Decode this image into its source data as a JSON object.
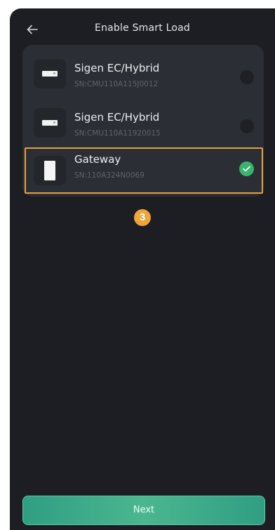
{
  "header": {
    "title": "Enable Smart Load",
    "back_icon": "arrow-left-icon"
  },
  "devices": [
    {
      "name": "Sigen EC/Hybrid",
      "sn": "SN:CMU110A115J0012",
      "selected": false,
      "icon": "inverter-device-icon"
    },
    {
      "name": "Sigen EC/Hybrid",
      "sn": "SN:CMU110A11920015",
      "selected": false,
      "icon": "inverter-device-icon"
    },
    {
      "name": "Gateway",
      "sn": "SN:110A324N0069",
      "selected": true,
      "icon": "gateway-device-icon"
    }
  ],
  "annotation": {
    "step_number": "3",
    "highlight_color": "#e9a03a"
  },
  "footer": {
    "next_label": "Next"
  },
  "colors": {
    "background": "#1c1e23",
    "card": "#2b2e34",
    "accent": "#39b46c",
    "button": "#3fae89"
  }
}
